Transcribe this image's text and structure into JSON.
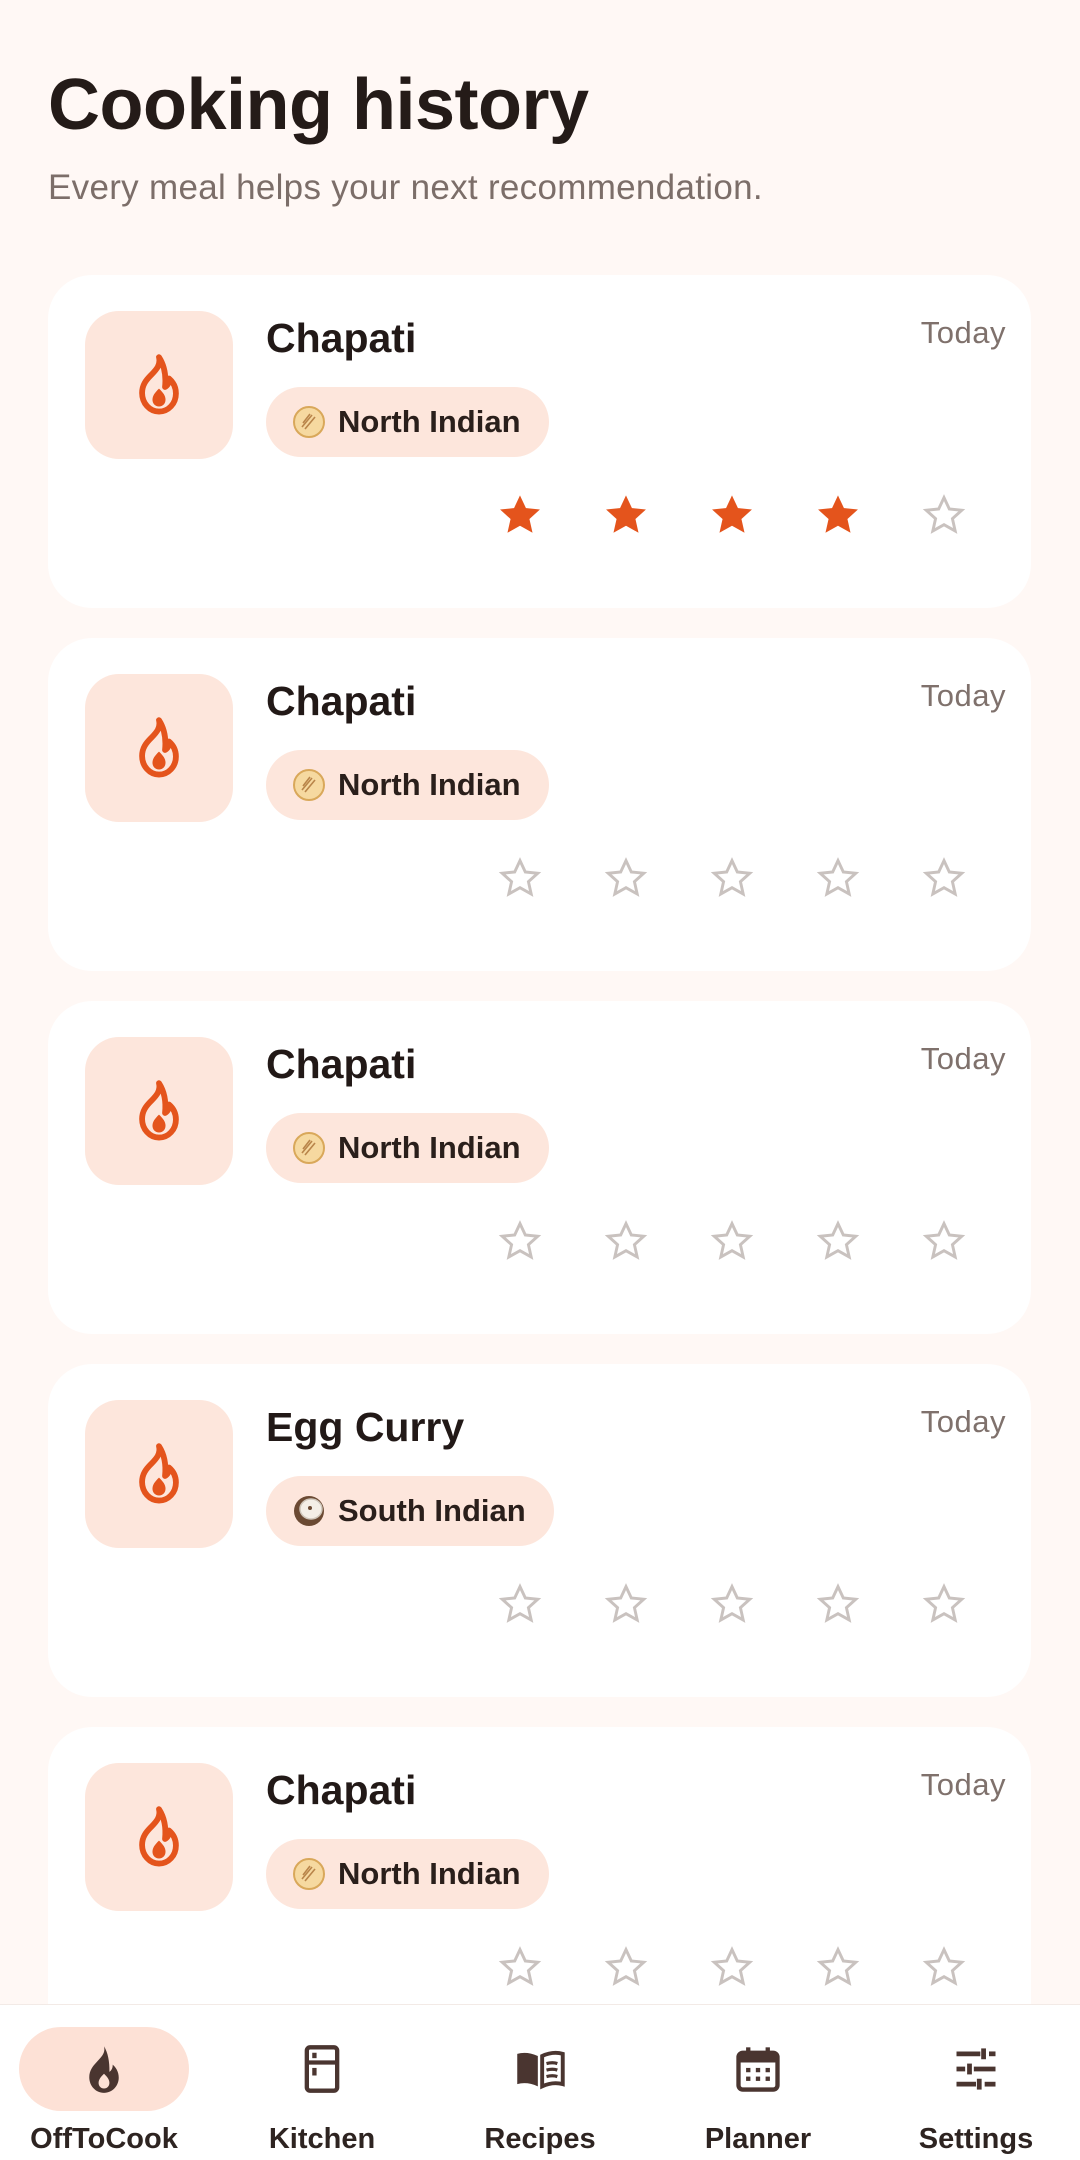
{
  "header": {
    "title": "Cooking history",
    "subtitle": "Every meal helps your next recommendation."
  },
  "colors": {
    "accent": "#E4541C",
    "chip_bg": "#FDE6DC",
    "background": "#FFF8F5",
    "star_empty": "#C9C2BF"
  },
  "history": [
    {
      "meal": "Chapati",
      "date": "Today",
      "cuisine": "North Indian",
      "cuisine_icon": "flatbread-icon",
      "rating": 4,
      "max_rating": 5
    },
    {
      "meal": "Chapati",
      "date": "Today",
      "cuisine": "North Indian",
      "cuisine_icon": "flatbread-icon",
      "rating": 0,
      "max_rating": 5
    },
    {
      "meal": "Chapati",
      "date": "Today",
      "cuisine": "North Indian",
      "cuisine_icon": "flatbread-icon",
      "rating": 0,
      "max_rating": 5
    },
    {
      "meal": "Egg Curry",
      "date": "Today",
      "cuisine": "South Indian",
      "cuisine_icon": "coconut-icon",
      "rating": 0,
      "max_rating": 5
    },
    {
      "meal": "Chapati",
      "date": "Today",
      "cuisine": "North Indian",
      "cuisine_icon": "flatbread-icon",
      "rating": 0,
      "max_rating": 5
    }
  ],
  "nav": {
    "items": [
      {
        "label": "OffToCook",
        "icon": "flame-icon",
        "active": true
      },
      {
        "label": "Kitchen",
        "icon": "fridge-icon",
        "active": false
      },
      {
        "label": "Recipes",
        "icon": "book-icon",
        "active": false
      },
      {
        "label": "Planner",
        "icon": "calendar-icon",
        "active": false
      },
      {
        "label": "Settings",
        "icon": "sliders-icon",
        "active": false
      }
    ]
  }
}
